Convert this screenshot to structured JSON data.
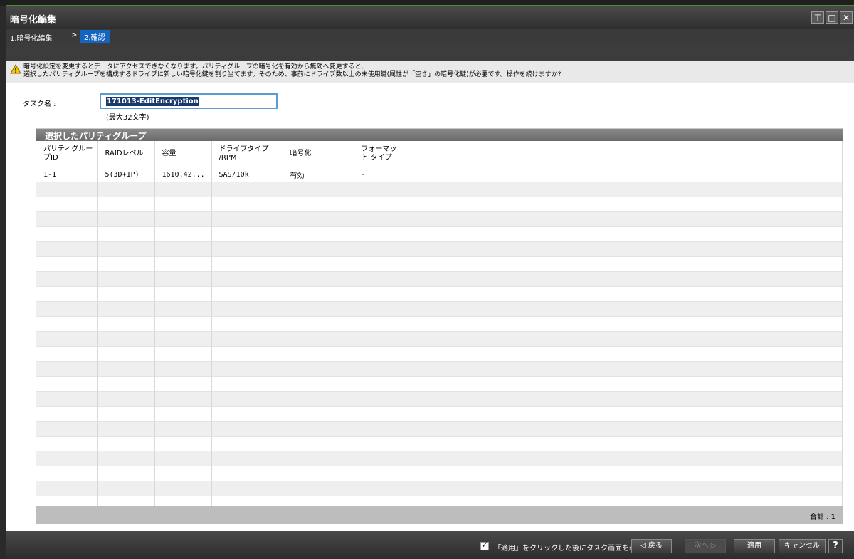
{
  "window": {
    "title": "暗号化編集",
    "controls": [
      "pin-icon",
      "maximize-icon",
      "close-icon"
    ]
  },
  "breadcrumb": {
    "step1": "1.暗号化編集",
    "separator": ">",
    "step2": "2.確認"
  },
  "warning": {
    "line1": "暗号化設定を変更するとデータにアクセスできなくなります。パリティグループの暗号化を有効から無効へ変更すると、",
    "line2": "選択したパリティグループを構成するドライブに新しい暗号化鍵を割り当てます。そのため、事前にドライブ数以上の未使用鍵(属性が「空き」の暗号化鍵)が必要です。操作を続けますか?"
  },
  "task": {
    "label": "タスク名 :",
    "value": "171013-EditEncryption",
    "note": "(最大32文字)"
  },
  "panel": {
    "title": "選択したパリティグループ",
    "columns": [
      "パリティグループID",
      "RAIDレベル",
      "容量",
      "ドライブタイプ /RPM",
      "暗号化",
      "フォーマット タイプ"
    ],
    "rows": [
      [
        "1-1",
        "5(3D+1P)",
        "1610.42...",
        "SAS/10k",
        "有効",
        "-"
      ]
    ],
    "total": "合計 : 1"
  },
  "bottom": {
    "checkbox_label": "「適用」をクリックした後にタスク画面を表示",
    "checkbox_checked": true,
    "back": "◁ 戻る",
    "next": "次へ ▷",
    "apply": "適用",
    "cancel": "キャンセル",
    "help": "?"
  },
  "colors": {
    "accent": "#1565c0",
    "panel_header": "#777777",
    "warning_bg": "#e9e9e9"
  }
}
